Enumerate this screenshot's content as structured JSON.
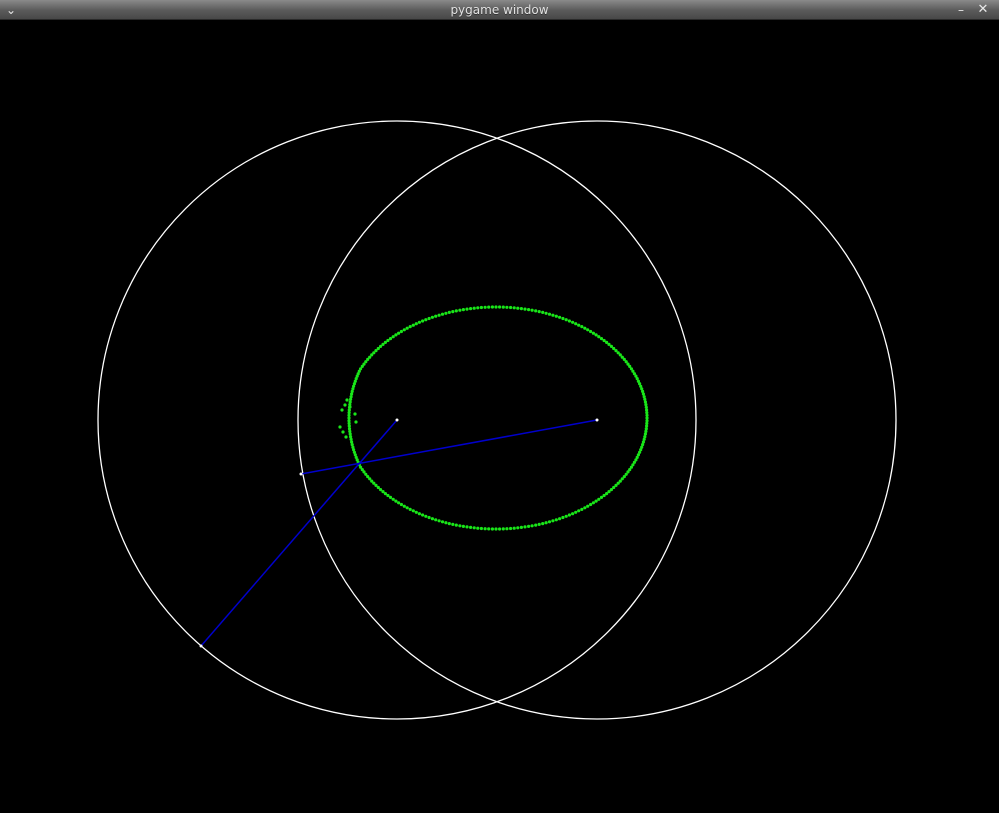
{
  "window": {
    "title": "pygame window",
    "controls": {
      "menu_icon": "chevron-down-icon",
      "minimize_icon": "minimize-icon",
      "close_icon": "close-icon",
      "menu_glyph": "⌄",
      "minimize_glyph": "–",
      "close_glyph": "✕"
    }
  },
  "scene": {
    "background": "#000000",
    "circle_color": "#ffffff",
    "arm_color": "#0000cc",
    "trace_color": "#19e619",
    "joint_color": "#ffffff"
  }
}
